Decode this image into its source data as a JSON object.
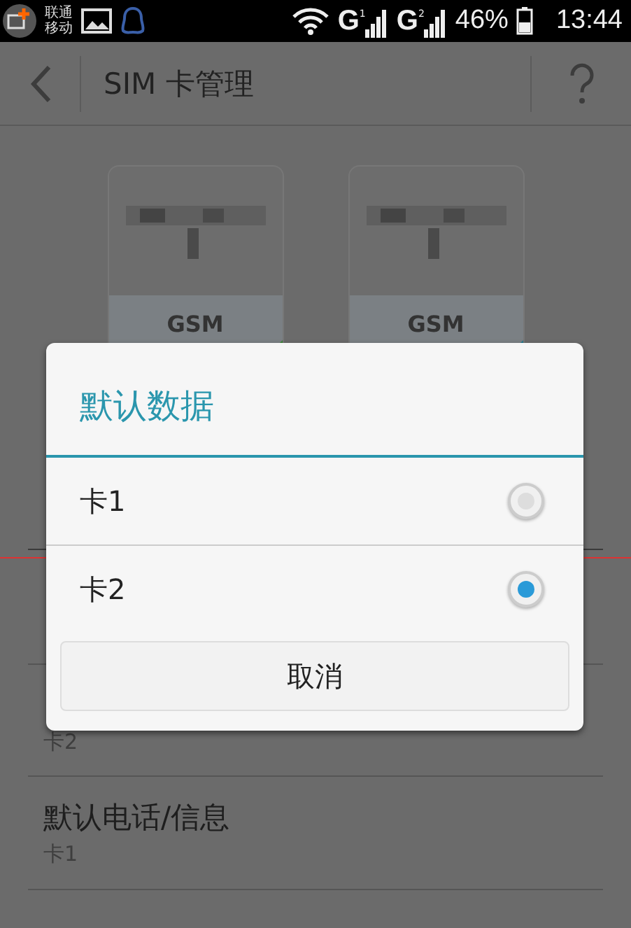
{
  "status_bar": {
    "carriers": [
      "联通",
      "移动"
    ],
    "signals": [
      {
        "network": "G",
        "sim": "1"
      },
      {
        "network": "G",
        "sim": "2"
      }
    ],
    "battery": "46%",
    "time": "13:44"
  },
  "action_bar": {
    "title": "SIM 卡管理"
  },
  "sim_cards": [
    {
      "network": "GSM"
    },
    {
      "network": "GSM"
    }
  ],
  "settings": [
    {
      "subtitle": "卡2"
    },
    {
      "title": "默认电话/信息",
      "subtitle": "卡1"
    }
  ],
  "dialog": {
    "title": "默认数据",
    "options": [
      {
        "label": "卡1",
        "selected": false
      },
      {
        "label": "卡2",
        "selected": true
      }
    ],
    "buttons": [
      "取消"
    ]
  }
}
